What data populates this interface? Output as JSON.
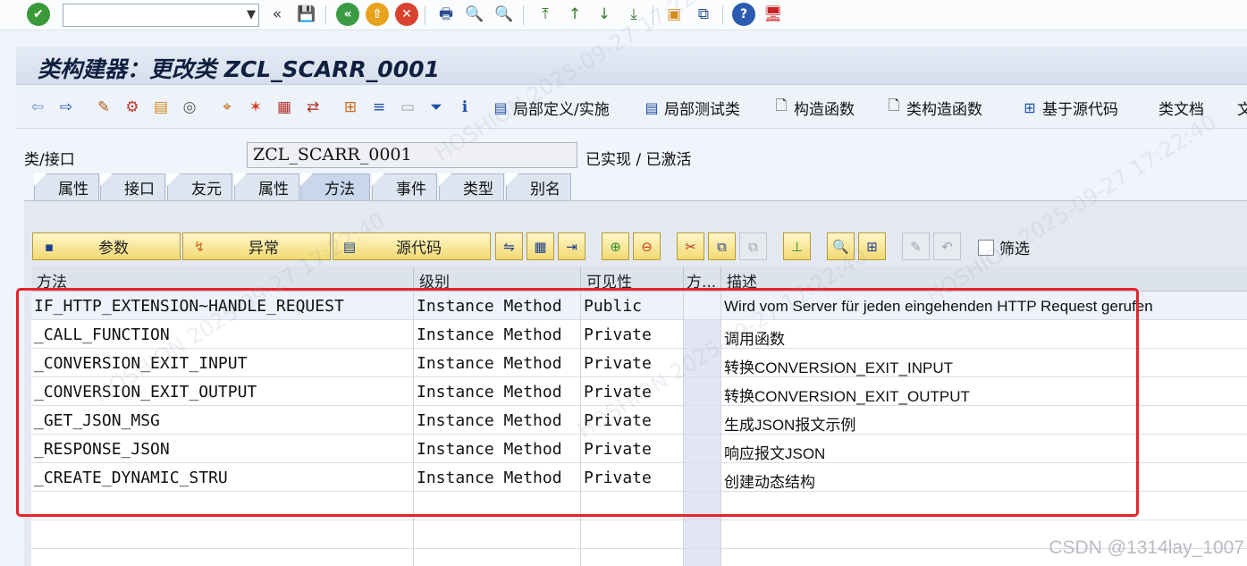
{
  "system_toolbar": {
    "command_field_value": "",
    "icons": [
      "check-icon",
      "save-icon",
      "back-icon",
      "exit-icon",
      "cancel-icon",
      "print-icon",
      "find-icon",
      "find-next-icon",
      "first-page-icon",
      "previous-page-icon",
      "next-page-icon",
      "last-page-icon",
      "new-session-icon",
      "shortcut-icon",
      "help-icon",
      "customize-layout-icon"
    ]
  },
  "title": "类构建器：更改类 ZCL_SCARR_0001",
  "app_toolbar": {
    "buttons": [
      {
        "label": "局部定义/实施",
        "icon": "local-definitions-icon"
      },
      {
        "label": "局部测试类",
        "icon": "local-test-classes-icon"
      },
      {
        "label": "构造函数",
        "icon": "constructor-icon"
      },
      {
        "label": "类构造函数",
        "icon": "class-constructor-icon"
      },
      {
        "label": "基于源代码",
        "icon": "source-code-based-icon"
      },
      {
        "label": "类文档",
        "icon": ""
      },
      {
        "label": "文",
        "icon": ""
      }
    ]
  },
  "class_field": {
    "label": "类/接口",
    "value": "ZCL_SCARR_0001",
    "status": "已实现 / 已激活"
  },
  "tabs": [
    {
      "label": "属性",
      "active": false
    },
    {
      "label": "接口",
      "active": false
    },
    {
      "label": "友元",
      "active": false
    },
    {
      "label": "属性",
      "active": false
    },
    {
      "label": "方法",
      "active": true
    },
    {
      "label": "事件",
      "active": false
    },
    {
      "label": "类型",
      "active": false
    },
    {
      "label": "别名",
      "active": false
    }
  ],
  "grid_toolbar": {
    "params_label": "参数",
    "exceptions_label": "异常",
    "source_label": "源代码",
    "filter_label": "筛选"
  },
  "table": {
    "headers": [
      "方法",
      "级别",
      "可见性",
      "方...",
      "描述"
    ],
    "rows": [
      {
        "method": "IF_HTTP_EXTENSION~HANDLE_REQUEST",
        "level": "Instance Method",
        "visibility": "Public",
        "desc": "Wird vom Server für jeden eingehenden HTTP Request gerufen"
      },
      {
        "method": "_CALL_FUNCTION",
        "level": "Instance Method",
        "visibility": "Private",
        "desc": "调用函数"
      },
      {
        "method": "_CONVERSION_EXIT_INPUT",
        "level": "Instance Method",
        "visibility": "Private",
        "desc": "转换CONVERSION_EXIT_INPUT"
      },
      {
        "method": "_CONVERSION_EXIT_OUTPUT",
        "level": "Instance Method",
        "visibility": "Private",
        "desc": "转换CONVERSION_EXIT_OUTPUT"
      },
      {
        "method": "_GET_JSON_MSG",
        "level": "Instance Method",
        "visibility": "Private",
        "desc": "生成JSON报文示例"
      },
      {
        "method": "_RESPONSE_JSON",
        "level": "Instance Method",
        "visibility": "Private",
        "desc": "响应报文JSON"
      },
      {
        "method": "_CREATE_DYNAMIC_STRU",
        "level": "Instance Method",
        "visibility": "Private",
        "desc": "创建动态结构"
      }
    ]
  },
  "watermark": "HOSHION 2025-09-27 17:22:40",
  "footer_mark": "CSDN @1314lay_1007"
}
